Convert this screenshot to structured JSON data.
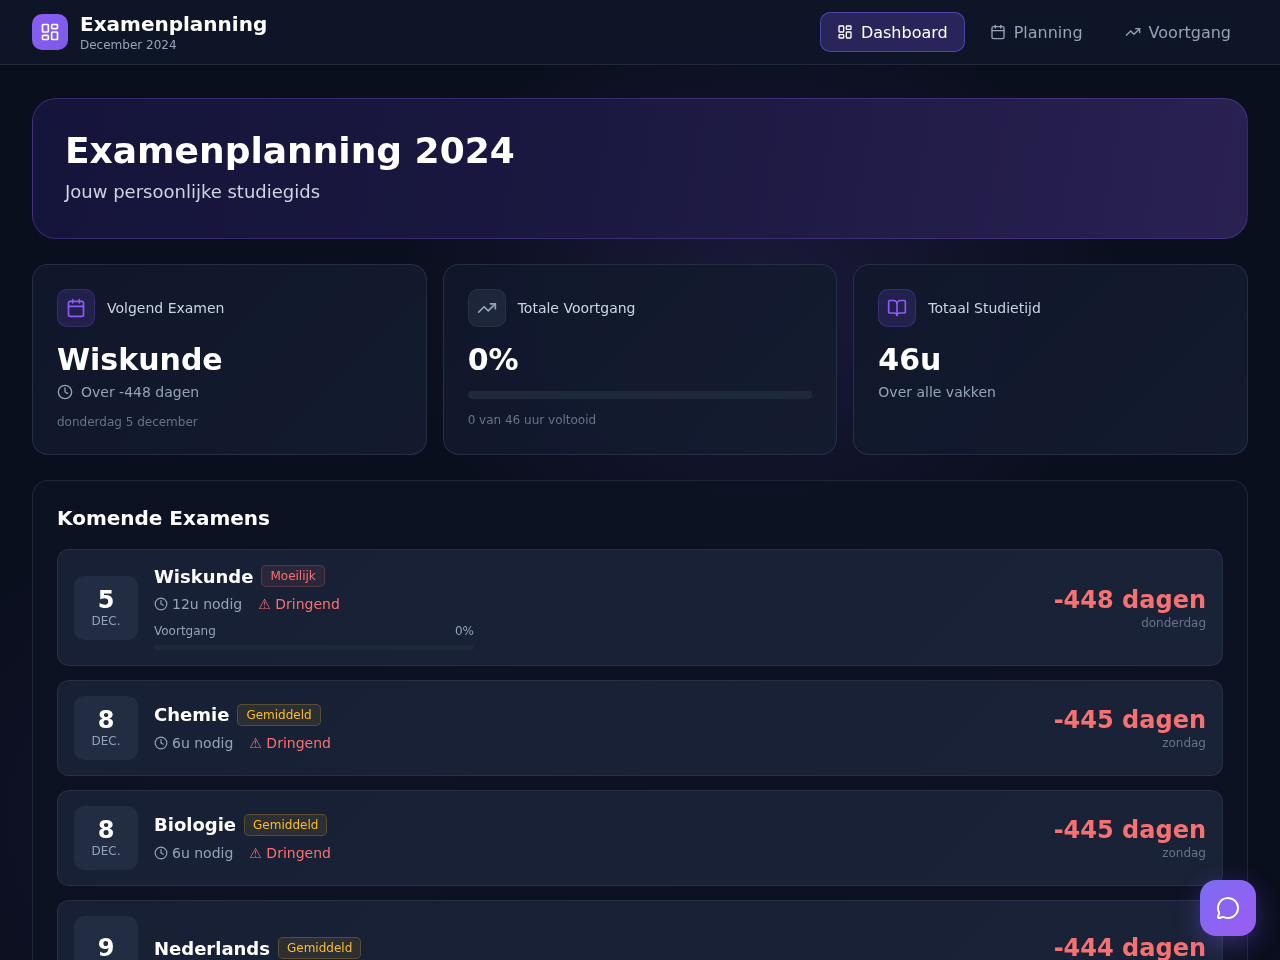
{
  "header": {
    "title": "Examenplanning",
    "subtitle": "December 2024"
  },
  "nav": [
    {
      "label": "Dashboard",
      "selected": true
    },
    {
      "label": "Planning",
      "selected": false
    },
    {
      "label": "Voortgang",
      "selected": false
    }
  ],
  "hero": {
    "title": "Examenplanning 2024",
    "subtitle": "Jouw persoonlijke studiegids"
  },
  "stats": [
    {
      "kind": "next_exam",
      "label": "Volgend Examen",
      "value": "Wiskunde",
      "countdown": "Over -448 dagen",
      "date": "donderdag 5 december"
    },
    {
      "kind": "progress",
      "label": "Totale Voortgang",
      "value": "0%",
      "level": 0,
      "note": "0 van 46 uur voltooid"
    },
    {
      "kind": "study_time",
      "label": "Totaal Studietijd",
      "value": "46u",
      "note": "Over alle vakken"
    }
  ],
  "upcoming": {
    "title": "Komende Examens",
    "exams": [
      {
        "day": "5",
        "month": "DEC.",
        "name": "Wiskunde",
        "difficulty": {
          "label": "Moeilijk",
          "color": "#f87171"
        },
        "hours": "12u nodig",
        "urgency": "⚠ Dringend",
        "countdown": "-448 dagen",
        "weekday": "donderdag",
        "progress": {
          "label": "Voortgang",
          "reading": "0%",
          "level": 0
        }
      },
      {
        "day": "8",
        "month": "DEC.",
        "name": "Chemie",
        "difficulty": {
          "label": "Gemiddeld",
          "color": "#fbbf24"
        },
        "hours": "6u nodig",
        "urgency": "⚠ Dringend",
        "countdown": "-445 dagen",
        "weekday": "zondag"
      },
      {
        "day": "8",
        "month": "DEC.",
        "name": "Biologie",
        "difficulty": {
          "label": "Gemiddeld",
          "color": "#fbbf24"
        },
        "hours": "6u nodig",
        "urgency": "⚠ Dringend",
        "countdown": "-445 dagen",
        "weekday": "zondag"
      },
      {
        "day": "9",
        "name": "Nederlands",
        "difficulty": {
          "label": "Gemiddeld",
          "color": "#fbbf24"
        },
        "countdown": "-444 dagen"
      }
    ]
  }
}
